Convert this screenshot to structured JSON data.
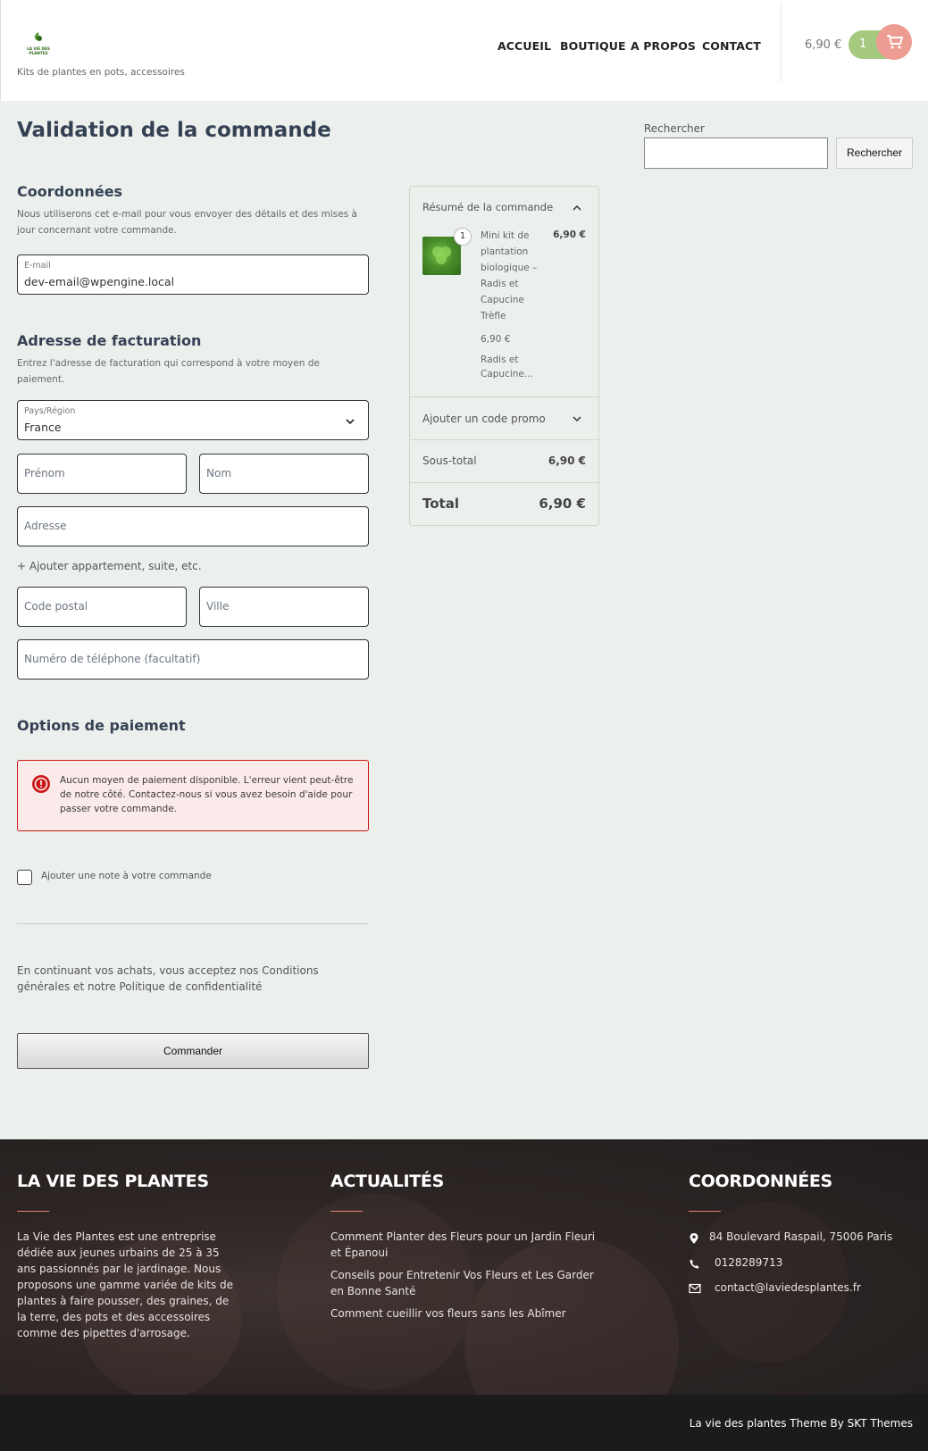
{
  "header": {
    "tagline": "Kits de plantes en pots, accessoires",
    "nav": [
      "ACCUEIL",
      "BOUTIQUE",
      "A PROPOS",
      "CONTACT"
    ],
    "cart_total": "6,90 €",
    "cart_count": "1"
  },
  "page_title": "Validation de la commande",
  "contact": {
    "heading": "Coordonnées",
    "desc": "Nous utiliserons cet e-mail pour vous envoyer des détails et des mises à jour concernant votre commande.",
    "email_label": "E-mail",
    "email_value": "dev-email@wpengine.local"
  },
  "billing": {
    "heading": "Adresse de facturation",
    "desc": "Entrez l'adresse de facturation qui correspond à votre moyen de paiement.",
    "country_label": "Pays/Région",
    "country_value": "France",
    "first_name": "Prénom",
    "last_name": "Nom",
    "address": "Adresse",
    "add_apartment": "+ Ajouter appartement, suite, etc.",
    "postcode": "Code postal",
    "city": "Ville",
    "phone": "Numéro de téléphone (facultatif)"
  },
  "payment": {
    "heading": "Options de paiement",
    "error": "Aucun moyen de paiement disponible. L'erreur vient peut-être de notre côté. Contactez-nous si vous avez besoin d'aide pour passer votre commande."
  },
  "note_label": "Ajouter une note à votre commande",
  "terms": "En continuant vos achats, vous acceptez nos Conditions générales et notre Politique de confidentialité",
  "order_button": "Commander",
  "summary": {
    "title": "Résumé de la commande",
    "item_qty": "1",
    "item_name": "Mini kit de plantation biologique – Radis et Capucine Trèfle",
    "item_price": "6,90 €",
    "item_unit_price": "6,90 €",
    "item_variation": "Radis et Capucine...",
    "promo": "Ajouter un code promo",
    "subtotal_label": "Sous-total",
    "subtotal_value": "6,90 €",
    "total_label": "Total",
    "total_value": "6,90 €"
  },
  "search": {
    "label": "Rechercher",
    "button": "Rechercher"
  },
  "footer": {
    "col1_title": "LA VIE DES PLANTES",
    "col1_text": "La Vie des Plantes est une entreprise dédiée aux jeunes urbains de 25 à 35 ans passionnés par le jardinage. Nous proposons une gamme variée de kits de plantes à faire pousser, des graines, de la terre, des pots et des accessoires comme des pipettes d'arrosage.",
    "col2_title": "ACTUALITÉS",
    "news": [
      "Comment Planter des Fleurs pour un Jardin Fleuri et Épanoui",
      "Conseils pour Entretenir Vos Fleurs et Les Garder en Bonne Santé",
      "Comment cueillir vos fleurs sans les Abîmer"
    ],
    "col3_title": "COORDONNÉES",
    "address": "84 Boulevard Raspail, 75006 Paris",
    "phone": "0128289713",
    "email": "contact@laviedesplantes.fr",
    "credits": "La vie des plantes Theme By SKT Themes"
  }
}
